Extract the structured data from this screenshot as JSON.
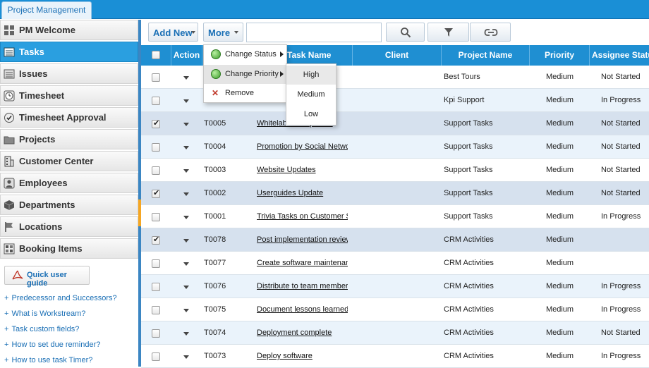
{
  "app": {
    "tab": "Project Management"
  },
  "sidebar": {
    "items": [
      {
        "label": "PM Welcome",
        "icon": "grid-icon"
      },
      {
        "label": "Tasks",
        "icon": "tasks-icon"
      },
      {
        "label": "Issues",
        "icon": "issues-icon"
      },
      {
        "label": "Timesheet",
        "icon": "clock-icon"
      },
      {
        "label": "Timesheet Approval",
        "icon": "check-circle-icon"
      },
      {
        "label": "Projects",
        "icon": "folder-icon"
      },
      {
        "label": "Customer Center",
        "icon": "building-icon"
      },
      {
        "label": "Employees",
        "icon": "user-icon"
      },
      {
        "label": "Departments",
        "icon": "cube-icon"
      },
      {
        "label": "Locations",
        "icon": "flag-icon"
      },
      {
        "label": "Booking Items",
        "icon": "booking-icon"
      }
    ],
    "guide_button": "Quick user guide",
    "help_links": [
      "Predecessor and Successors?",
      "What is Workstream?",
      "Task custom fields?",
      "How to set due reminder?",
      "How to use task Timer?"
    ]
  },
  "toolbar": {
    "add_new": "Add New",
    "more": "More",
    "search_value": ""
  },
  "menu": {
    "items": [
      "Change Status",
      "Change Priority",
      "Remove"
    ],
    "priority_options": [
      "High",
      "Medium",
      "Low"
    ]
  },
  "grid": {
    "headers": [
      "Action",
      "Task Name",
      "Client",
      "Project Name",
      "Priority",
      "Assignee Status"
    ],
    "rows": [
      {
        "id": "",
        "name": "",
        "project": "Best Tours",
        "priority": "Medium",
        "status": "Not Started",
        "checked": false
      },
      {
        "id": "",
        "name": "",
        "project": "Kpi Support",
        "priority": "Medium",
        "status": "In Progress",
        "checked": false
      },
      {
        "id": "T0005",
        "name": "Whitelabel companies",
        "project": "Support Tasks",
        "priority": "Medium",
        "status": "Not Started",
        "checked": true
      },
      {
        "id": "T0004",
        "name": "Promotion by Social Networ",
        "project": "Support Tasks",
        "priority": "Medium",
        "status": "Not Started",
        "checked": false
      },
      {
        "id": "T0003",
        "name": "Website Updates",
        "project": "Support Tasks",
        "priority": "Medium",
        "status": "Not Started",
        "checked": false
      },
      {
        "id": "T0002",
        "name": "Userguides Update",
        "project": "Support Tasks",
        "priority": "Medium",
        "status": "Not Started",
        "checked": true
      },
      {
        "id": "T0001",
        "name": "Trivia Tasks on Customer S",
        "project": "Support Tasks",
        "priority": "Medium",
        "status": "In Progress",
        "checked": false
      },
      {
        "id": "T0078",
        "name": "Post implementation review",
        "project": "CRM Activities",
        "priority": "Medium",
        "status": "",
        "checked": true
      },
      {
        "id": "T0077",
        "name": "Create software maintenan",
        "project": "CRM Activities",
        "priority": "Medium",
        "status": "",
        "checked": false
      },
      {
        "id": "T0076",
        "name": "Distribute to team members",
        "project": "CRM Activities",
        "priority": "Medium",
        "status": "In Progress",
        "checked": false
      },
      {
        "id": "T0075",
        "name": "Document lessons learned",
        "project": "CRM Activities",
        "priority": "Medium",
        "status": "In Progress",
        "checked": false
      },
      {
        "id": "T0074",
        "name": "Deployment complete",
        "project": "CRM Activities",
        "priority": "Medium",
        "status": "Not Started",
        "checked": false
      },
      {
        "id": "T0073",
        "name": "Deploy software",
        "project": "CRM Activities",
        "priority": "Medium",
        "status": "In Progress",
        "checked": false
      }
    ]
  }
}
